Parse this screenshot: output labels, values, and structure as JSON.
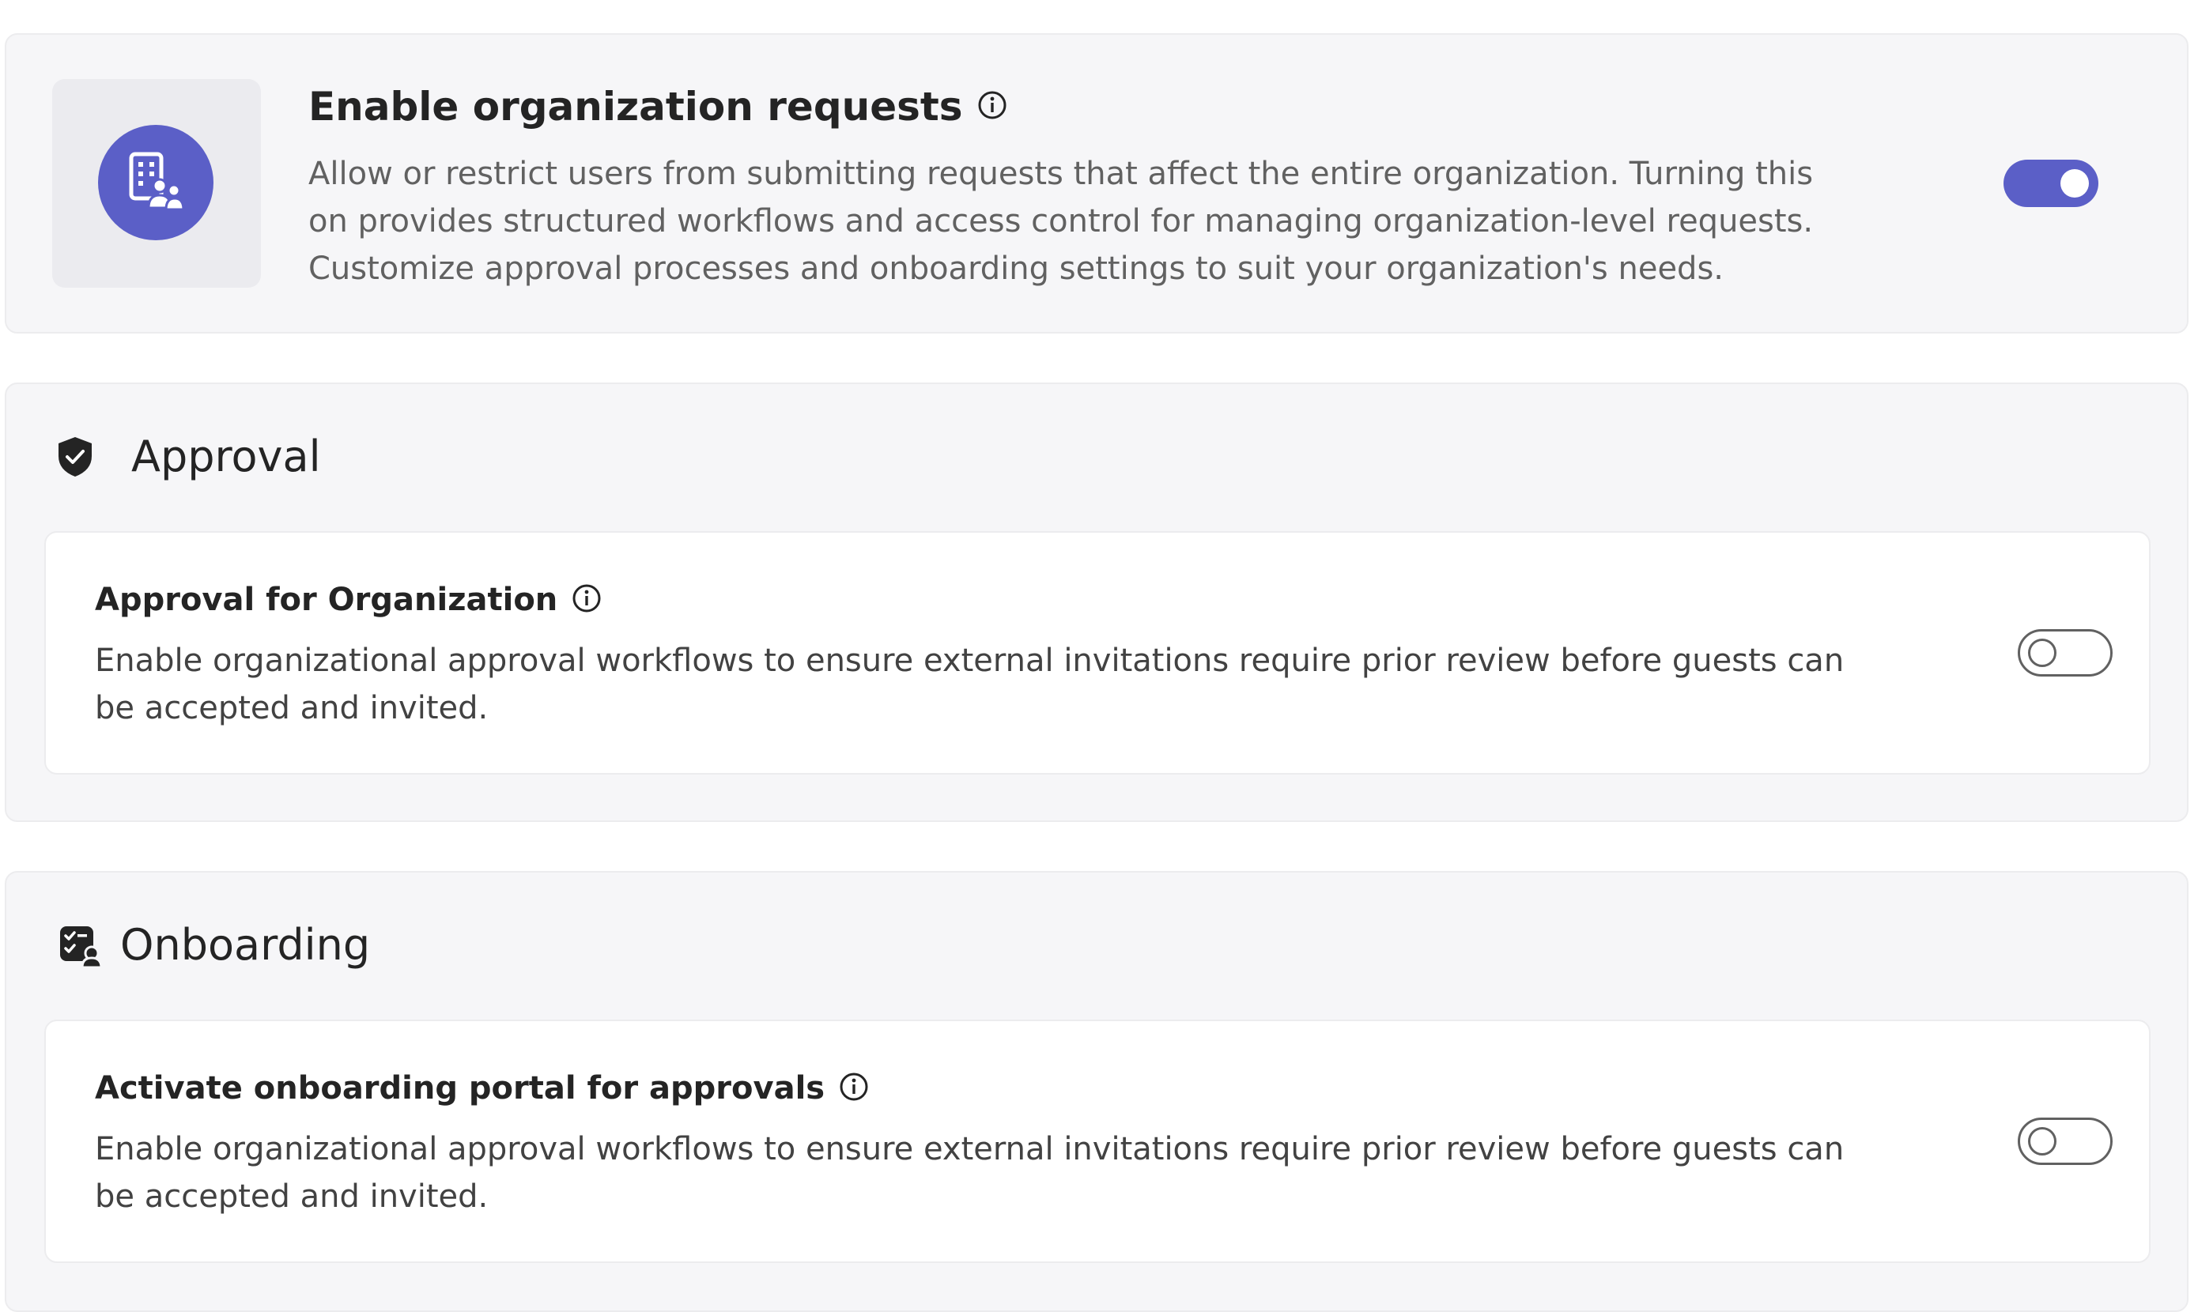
{
  "org_requests": {
    "title": "Enable organization requests",
    "description": "Allow or restrict users from submitting requests that affect the entire organization. Turning this on provides structured workflows and access control for managing organization-level requests. Customize approval processes and onboarding settings to suit your organization's needs.",
    "enabled": true,
    "icon": "organization-people-icon",
    "accent_color": "#5b5fc7"
  },
  "approval_section": {
    "title": "Approval",
    "icon": "shield-check-icon",
    "setting": {
      "title": "Approval for Organization",
      "description": "Enable organizational approval workflows to ensure external invitations require prior review before guests can be accepted and invited.",
      "enabled": false
    }
  },
  "onboarding_section": {
    "title": "Onboarding",
    "icon": "checklist-person-icon",
    "setting": {
      "title": "Activate onboarding portal for approvals",
      "description": "Enable organizational approval workflows to ensure external invitations require prior review before guests can be accepted and invited.",
      "enabled": false
    }
  }
}
